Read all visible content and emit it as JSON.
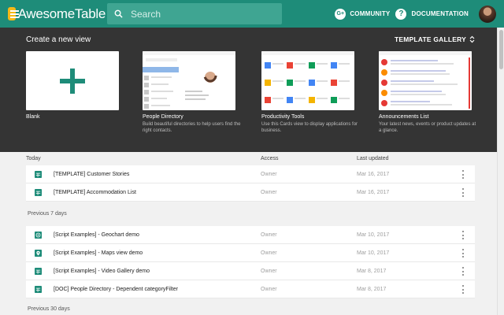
{
  "app": {
    "name": "AwesomeTable"
  },
  "search": {
    "placeholder": "Search"
  },
  "nav": {
    "community": "COMMUNITY",
    "documentation": "DOCUMENTATION",
    "gplus": "G+",
    "help": "?"
  },
  "create": {
    "title": "Create a new view",
    "gallery_label": "TEMPLATE GALLERY",
    "cards": [
      {
        "title": "Blank",
        "desc": ""
      },
      {
        "title": "People Directory",
        "desc": "Build beautiful directories to help users find the right contacts."
      },
      {
        "title": "Productivity Tools",
        "desc": "Use this Cards view to display applications for business."
      },
      {
        "title": "Announcements List",
        "desc": "Your latest news, events or product updates at a glance."
      }
    ]
  },
  "list": {
    "headers": {
      "name": "Today",
      "access": "Access",
      "updated": "Last updated"
    },
    "sections": [
      {
        "label": "Today",
        "rows": [
          {
            "name": "[TEMPLATE] Customer Stories",
            "access": "Owner",
            "date": "Mar 16, 2017",
            "icon": "table-icon"
          },
          {
            "name": "[TEMPLATE] Accommodation List",
            "access": "Owner",
            "date": "Mar 16, 2017",
            "icon": "table-icon"
          }
        ]
      },
      {
        "label": "Previous 7 days",
        "rows": [
          {
            "name": "[Script Examples] - Geochart demo",
            "access": "Owner",
            "date": "Mar 10, 2017",
            "icon": "geochart-icon"
          },
          {
            "name": "[Script Examples] - Maps view demo",
            "access": "Owner",
            "date": "Mar 10, 2017",
            "icon": "map-pin-icon"
          },
          {
            "name": "[Script Examples] - Video Gallery demo",
            "access": "Owner",
            "date": "Mar 8, 2017",
            "icon": "table-icon"
          },
          {
            "name": "[DOC] People Directory - Dependent categoryFilter",
            "access": "Owner",
            "date": "Mar 8, 2017",
            "icon": "table-icon"
          }
        ]
      },
      {
        "label": "Previous 30 days",
        "rows": []
      }
    ]
  },
  "colors": {
    "brand": "#1e8c79",
    "panel": "#343434",
    "accent_logo": "#f5b818"
  }
}
